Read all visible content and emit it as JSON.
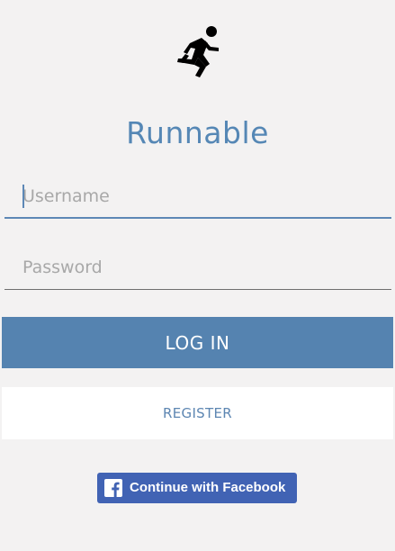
{
  "app": {
    "title": "Runnable",
    "logo_icon": "running-person-icon"
  },
  "login_form": {
    "username": {
      "placeholder": "Username",
      "value": ""
    },
    "password": {
      "placeholder": "Password",
      "value": ""
    },
    "login_label": "LOG IN",
    "register_label": "REGISTER"
  },
  "facebook": {
    "label": "Continue with Facebook",
    "icon": "facebook-icon"
  },
  "colors": {
    "brand_blue": "#5583b0",
    "title_blue": "#5587b5",
    "facebook_blue": "#4163b4",
    "background": "#f3f2f2"
  }
}
